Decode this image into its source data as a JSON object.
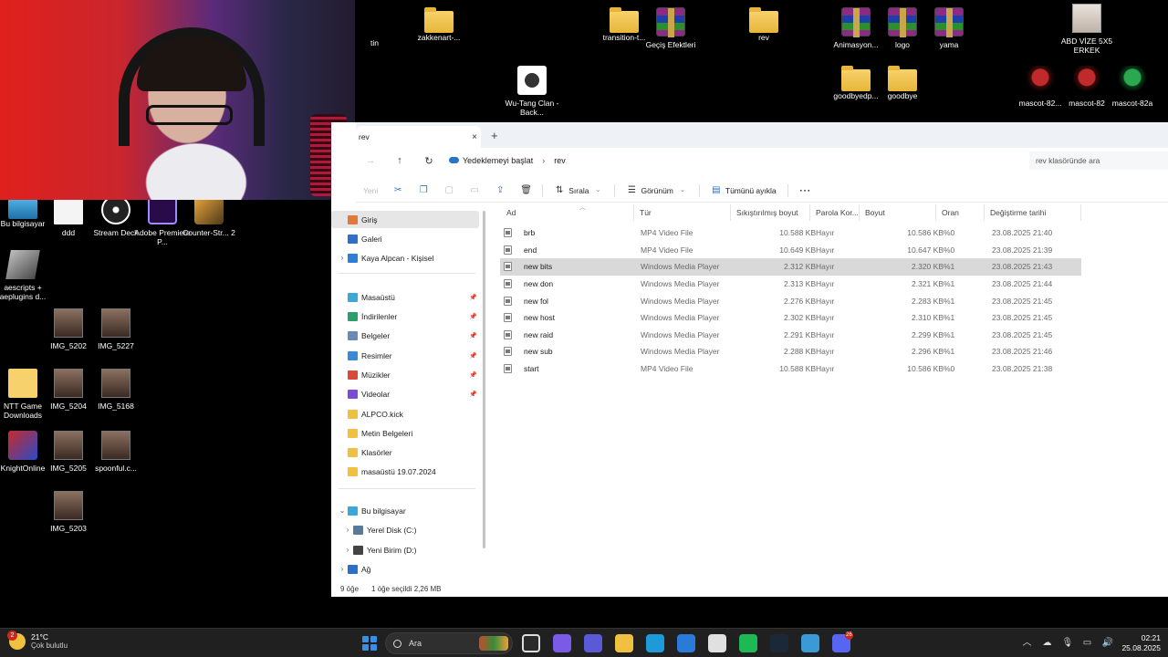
{
  "desktop": {
    "icons": [
      {
        "label": "tin",
        "kind": "partial"
      },
      {
        "label": "zakkenart-...",
        "kind": "folder"
      },
      {
        "label": "transition-t...",
        "kind": "folder"
      },
      {
        "label": "Geçiş Efektleri",
        "kind": "rar"
      },
      {
        "label": "rev",
        "kind": "folder"
      },
      {
        "label": "Animasyon...",
        "kind": "rar"
      },
      {
        "label": "logo",
        "kind": "rar"
      },
      {
        "label": "yama",
        "kind": "rar"
      },
      {
        "label": "ABD VİZE 5X5 ERKEK",
        "kind": "person"
      },
      {
        "label": "Wu-Tang Clan - Back...",
        "kind": "media"
      },
      {
        "label": "goodbyedp...",
        "kind": "folder"
      },
      {
        "label": "goodbye",
        "kind": "folder"
      },
      {
        "label": "mascot-82...",
        "kind": "mascot"
      },
      {
        "label": "mascot-82",
        "kind": "mascot"
      },
      {
        "label": "mascot-82a",
        "kind": "mascot-green"
      },
      {
        "label": "Bu bilgisayar",
        "kind": "pc"
      },
      {
        "label": "ddd",
        "kind": "doc"
      },
      {
        "label": "Stream Deck",
        "kind": "deck"
      },
      {
        "label": "Adobe Premiere P...",
        "kind": "pr"
      },
      {
        "label": "Counter-Str... 2",
        "kind": "cs"
      },
      {
        "label": "aescripts + aeplugins d...",
        "kind": "ae"
      },
      {
        "label": "IMG_5202",
        "kind": "photo"
      },
      {
        "label": "IMG_5227",
        "kind": "photo"
      },
      {
        "label": "NTT Game Downloads",
        "kind": "ntt"
      },
      {
        "label": "IMG_5204",
        "kind": "photo"
      },
      {
        "label": "IMG_5168",
        "kind": "photo"
      },
      {
        "label": "KnightOnline",
        "kind": "ko"
      },
      {
        "label": "IMG_5205",
        "kind": "photo"
      },
      {
        "label": "spoonful.c...",
        "kind": "photo"
      },
      {
        "label": "IMG_5203",
        "kind": "photo"
      }
    ]
  },
  "explorer": {
    "tab_title": "rev",
    "tab_close": "×",
    "new_tab": "+",
    "nav": {
      "back": "←",
      "forward": "→",
      "up": "↑",
      "refresh": "↻"
    },
    "breadcrumb": [
      "Yedeklemeyi başlat",
      "rev"
    ],
    "breadcrumb_sep": "›",
    "search_placeholder": "rev klasöründe ara",
    "toolbar": {
      "new": "Yeni",
      "sort": "Sırala",
      "view": "Görünüm",
      "select_all": "Tümünü ayıkla",
      "more": "⋯"
    },
    "sidebar": {
      "items": [
        {
          "label": "Giriş",
          "color": "#e07a3a",
          "chev": ""
        },
        {
          "label": "Galeri",
          "color": "#2d6fc9",
          "chev": ""
        },
        {
          "label": "Kaya Alpcan - Kişisel",
          "color": "#2d7fd6",
          "chev": "›"
        },
        {
          "label": "Masaüstü",
          "color": "#3aa8d8",
          "pin": true
        },
        {
          "label": "İndirilenler",
          "color": "#2d9d6a",
          "pin": true
        },
        {
          "label": "Belgeler",
          "color": "#6a8ab8",
          "pin": true
        },
        {
          "label": "Resimler",
          "color": "#3a8ad8",
          "pin": true
        },
        {
          "label": "Müzikler",
          "color": "#d84a3a",
          "pin": true
        },
        {
          "label": "Videolar",
          "color": "#7a4ad8",
          "pin": true
        },
        {
          "label": "ALPCO.kick",
          "color": "#f0c040"
        },
        {
          "label": "Metin Belgeleri",
          "color": "#f0c040"
        },
        {
          "label": "Klasörler",
          "color": "#f0c040"
        },
        {
          "label": "masaüstü 19.07.2024",
          "color": "#f0c040"
        },
        {
          "label": "Bu bilgisayar",
          "color": "#3aa8d8",
          "chev": "⌄"
        },
        {
          "label": "Yerel Disk (C:)",
          "color": "#5a7a9a",
          "chev": "›"
        },
        {
          "label": "Yeni Birim (D:)",
          "color": "#444",
          "chev": "›"
        },
        {
          "label": "Ağ",
          "color": "#2d6fc9",
          "chev": "›"
        }
      ]
    },
    "columns": {
      "name": "Ad",
      "type": "Tür",
      "compressed": "Sıkıştırılmış boyut",
      "password": "Parola Kor...",
      "size": "Boyut",
      "ratio": "Oran",
      "modified": "Değiştirme tarihi"
    },
    "rows": [
      {
        "name": "brb",
        "type": "MP4 Video File",
        "compressed": "10.588 KB",
        "password": "Hayır",
        "size": "10.586 KB",
        "ratio": "%0",
        "modified": "23.08.2025 21:40"
      },
      {
        "name": "end",
        "type": "MP4 Video File",
        "compressed": "10.649 KB",
        "password": "Hayır",
        "size": "10.647 KB",
        "ratio": "%0",
        "modified": "23.08.2025 21:39"
      },
      {
        "name": "new bits",
        "type": "Windows Media Player",
        "compressed": "2.312 KB",
        "password": "Hayır",
        "size": "2.320 KB",
        "ratio": "%1",
        "modified": "23.08.2025 21:43",
        "selected": true
      },
      {
        "name": "new don",
        "type": "Windows Media Player",
        "compressed": "2.313 KB",
        "password": "Hayır",
        "size": "2.321 KB",
        "ratio": "%1",
        "modified": "23.08.2025 21:44"
      },
      {
        "name": "new fol",
        "type": "Windows Media Player",
        "compressed": "2.276 KB",
        "password": "Hayır",
        "size": "2.283 KB",
        "ratio": "%1",
        "modified": "23.08.2025 21:45"
      },
      {
        "name": "new host",
        "type": "Windows Media Player",
        "compressed": "2.302 KB",
        "password": "Hayır",
        "size": "2.310 KB",
        "ratio": "%1",
        "modified": "23.08.2025 21:45"
      },
      {
        "name": "new raid",
        "type": "Windows Media Player",
        "compressed": "2.291 KB",
        "password": "Hayır",
        "size": "2.299 KB",
        "ratio": "%1",
        "modified": "23.08.2025 21:45"
      },
      {
        "name": "new sub",
        "type": "Windows Media Player",
        "compressed": "2.288 KB",
        "password": "Hayır",
        "size": "2.296 KB",
        "ratio": "%1",
        "modified": "23.08.2025 21:46"
      },
      {
        "name": "start",
        "type": "MP4 Video File",
        "compressed": "10.588 KB",
        "password": "Hayır",
        "size": "10.586 KB",
        "ratio": "%0",
        "modified": "23.08.2025 21:38"
      }
    ],
    "status": {
      "count": "9 öğe",
      "selection": "1 öğe seçildi  2,26 MB"
    }
  },
  "taskbar": {
    "weather": {
      "temp": "21°C",
      "desc": "Çok bulutlu",
      "badge": "2"
    },
    "search_label": "Ara",
    "clock": {
      "time": "02:21",
      "date": "25.08.2025"
    },
    "apps": [
      {
        "name": "file-explorer-icon",
        "color": "#2a2a2a"
      },
      {
        "name": "copilot-icon",
        "color": "#7a5ae6"
      },
      {
        "name": "teams-icon",
        "color": "#5a5ad8"
      },
      {
        "name": "folder-icon",
        "color": "#f0c040"
      },
      {
        "name": "edge-icon",
        "color": "#1f9ad8"
      },
      {
        "name": "store-icon",
        "color": "#2a7ad8"
      },
      {
        "name": "chrome-icon",
        "color": "#e0e0e0"
      },
      {
        "name": "spotify-icon",
        "color": "#1db954"
      },
      {
        "name": "steam-icon",
        "color": "#1b2838"
      },
      {
        "name": "settings-icon",
        "color": "#3a9ad8"
      },
      {
        "name": "discord-icon",
        "color": "#5865f2",
        "badge": "26"
      }
    ]
  }
}
